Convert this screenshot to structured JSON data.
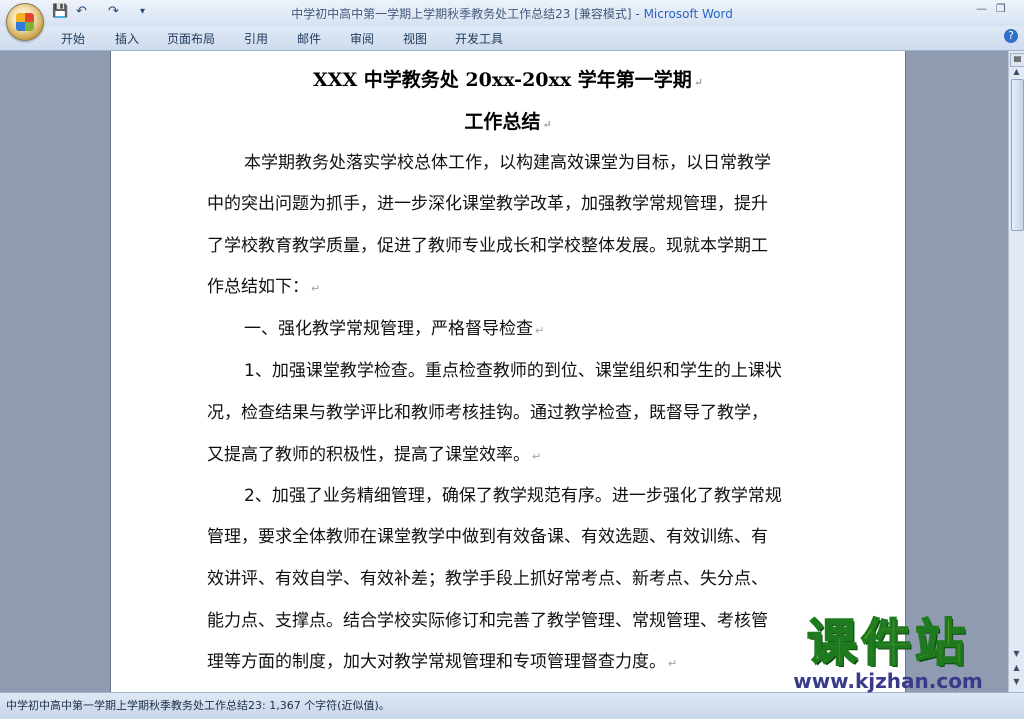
{
  "titlebar": {
    "doc_title": "中学初中高中第一学期上学期秋季教务处工作总结23 [兼容模式] - ",
    "app_name": "Microsoft Word",
    "qat_save": "💾",
    "qat_undo": "↶",
    "qat_redo": "↷",
    "qat_more": "▾",
    "minimize": "—",
    "restore": "❐"
  },
  "ribbon": {
    "tabs": [
      "开始",
      "插入",
      "页面布局",
      "引用",
      "邮件",
      "审阅",
      "视图",
      "开发工具"
    ],
    "help": "?"
  },
  "document": {
    "title_line1": "XXX 中学教务处 20xx-20xx 学年第一学期",
    "title_line2": "工作总结",
    "lines": [
      "本学期教务处落实学校总体工作，以构建高效课堂为目标，以日常教学",
      "中的突出问题为抓手，进一步深化课堂教学改革，加强教学常规管理，提升",
      "了学校教育教学质量，促进了教师专业成长和学校整体发展。现就本学期工",
      "作总结如下：",
      "一、强化教学常规管理，严格督导检查",
      "1、加强课堂教学检查。重点检查教师的到位、课堂组织和学生的上课状",
      "况，检查结果与教学评比和教师考核挂钩。通过教学检查，既督导了教学，",
      "又提高了教师的积极性，提高了课堂效率。",
      "2、加强了业务精细管理，确保了教学规范有序。进一步强化了教学常规",
      "管理，要求全体教师在课堂教学中做到有效备课、有效选题、有效训练、有",
      "效讲评、有效自学、有效补差；教学手段上抓好常考点、新考点、失分点、",
      "能力点、支撑点。结合学校实际修订和完善了教学管理、常规管理、考核管",
      "理等方面的制度，加大对教学常规管理和专项管理督查力度。"
    ],
    "para_mark": "↵"
  },
  "watermark": {
    "main": "课件站",
    "url": "www.kjzhan.com"
  },
  "statusbar": {
    "text": "中学初中高中第一学期上学期秋季教务处工作总结23: 1,367 个字符(近似值)。"
  }
}
